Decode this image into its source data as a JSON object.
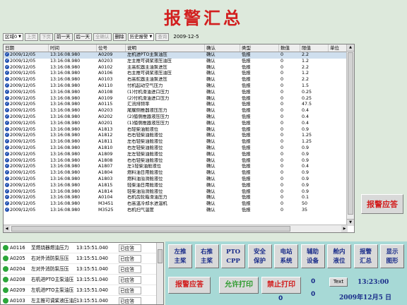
{
  "title": "报警汇总",
  "toolbar": {
    "region": "区域0",
    "prev_page": "上页",
    "next_page": "下页",
    "prev_day": "前一天",
    "next_day": "后一天",
    "confirm_all": "全确认",
    "delete": "删除",
    "history": "历史报警",
    "query": "查询",
    "date": "2009-12-5"
  },
  "grid": {
    "columns": [
      "日期",
      "时间",
      "位号",
      "说明",
      "确认",
      "类型",
      "数值",
      "限值",
      "单位"
    ],
    "rows": [
      [
        "2009/12/05",
        "13:16:08.980",
        "A0209",
        "左机进PTO主泵油压",
        "确认",
        "低报",
        "0",
        "2.2",
        ""
      ],
      [
        "2009/12/05",
        "13:16:08.980",
        "A0203",
        "左主推可调桨液压油压",
        "确认",
        "低报",
        "0",
        "1.2",
        ""
      ],
      [
        "2009/12/05",
        "13:16:08.980",
        "A0102",
        "主高舵器主油泵进压",
        "确认",
        "低报",
        "0",
        "2.2",
        ""
      ],
      [
        "2009/12/05",
        "13:16:08.980",
        "A0106",
        "右主推可调桨液压油压",
        "确认",
        "低报",
        "0",
        "1.2",
        ""
      ],
      [
        "2009/12/05",
        "13:16:08.980",
        "A0103",
        "右高舵器主油泵进压",
        "确认",
        "低报",
        "0",
        "2.2",
        ""
      ],
      [
        "2009/12/05",
        "13:16:08.980",
        "A0110",
        "付机起动空气压力",
        "确认",
        "低报",
        "0",
        "1.5",
        ""
      ],
      [
        "2009/12/05",
        "13:16:08.980",
        "A0108",
        "(1)付机滑油进口压力",
        "确认",
        "低报",
        "0",
        "0.25",
        ""
      ],
      [
        "2009/12/05",
        "13:16:08.980",
        "A0109",
        "(2)付机滑油进口压力",
        "确认",
        "低报",
        "0",
        "0.25",
        ""
      ],
      [
        "2009/12/05",
        "13:16:08.980",
        "A0115",
        "汇流排频率",
        "确认",
        "低报",
        "0",
        "47.5",
        ""
      ],
      [
        "2009/12/05",
        "13:16:08.980",
        "A0203",
        "尾艉侧推器液压压力",
        "确认",
        "低报",
        "0",
        "0.4",
        ""
      ],
      [
        "2009/12/05",
        "13:16:08.980",
        "A0202",
        "(2)艏侧推器液压压力",
        "确认",
        "低报",
        "0",
        "0.4",
        ""
      ],
      [
        "2009/12/05",
        "13:16:08.980",
        "A0201",
        "(1)艏侧推器液压压力",
        "确认",
        "低报",
        "0",
        "0.4",
        ""
      ],
      [
        "2009/12/05",
        "13:16:08.980",
        "A1813",
        "右轻柴油舱液位",
        "确认",
        "低报",
        "0",
        "0.9",
        ""
      ],
      [
        "2009/12/05",
        "13:16:08.980",
        "A1812",
        "右右轻柴油舱液位",
        "确认",
        "低报",
        "0",
        "1.25",
        ""
      ],
      [
        "2009/12/05",
        "13:16:08.980",
        "A1811",
        "左右轻柴油舱液位",
        "确认",
        "低报",
        "0",
        "1.25",
        ""
      ],
      [
        "2009/12/05",
        "13:16:08.980",
        "A1810",
        "右左轻柴油舱液位",
        "确认",
        "低报",
        "0",
        "0.9",
        ""
      ],
      [
        "2009/12/05",
        "13:16:08.980",
        "A1809",
        "左左轻柴油舱液位",
        "确认",
        "低报",
        "0",
        "0.9",
        ""
      ],
      [
        "2009/12/05",
        "13:16:08.980",
        "A1808",
        "右右轻柴油舱液位",
        "确认",
        "低报",
        "0",
        "0.9",
        ""
      ],
      [
        "2009/12/05",
        "13:16:08.980",
        "A1807",
        "左1轻柴油舱液位",
        "确认",
        "低报",
        "0",
        "0.4",
        ""
      ],
      [
        "2009/12/05",
        "13:16:08.980",
        "A1804",
        "燃料油日用舱液位",
        "确认",
        "低报",
        "0",
        "0.9",
        ""
      ],
      [
        "2009/12/05",
        "13:16:08.980",
        "A1803",
        "燃料油溢滑舱液位",
        "确认",
        "低报",
        "0",
        "0.9",
        ""
      ],
      [
        "2009/12/05",
        "13:16:08.980",
        "A1815",
        "轻柴油日用舱液位",
        "确认",
        "低报",
        "0",
        "0.9",
        ""
      ],
      [
        "2009/12/05",
        "13:16:08.980",
        "A1814",
        "轻柴油溢滑舱液位",
        "确认",
        "低报",
        "0",
        "0.9",
        ""
      ],
      [
        "2009/12/05",
        "13:16:08.980",
        "A0104",
        "右机齿轮箱滑油压力",
        "确认",
        "低报",
        "0",
        "0.1",
        ""
      ],
      [
        "2009/12/05",
        "13:16:08.980",
        "M3451",
        "右高温冷却水进温机",
        "确认",
        "低报",
        "0",
        "50",
        ""
      ],
      [
        "2009/12/05",
        "13:16:08.980",
        "M3525",
        "右机扫气温度",
        "确认",
        "低报",
        "0",
        "35",
        ""
      ]
    ]
  },
  "ack_side": "报警应答",
  "alarms": [
    {
      "code": "A0116",
      "desc": "至燃烧器燃油压力",
      "time": "13:15:51.040",
      "status": "已应答"
    },
    {
      "code": "A0205",
      "desc": "右对外消防泵压压",
      "time": "13:15:51.040",
      "status": "已应答"
    },
    {
      "code": "A0204",
      "desc": "左对外消防泵压压",
      "time": "13:15:51.040",
      "status": "已应答"
    },
    {
      "code": "A0208",
      "desc": "右机进PTO主泵油压",
      "time": "13:15:51.040",
      "status": "已应答"
    },
    {
      "code": "A0209",
      "desc": "左机进PTO主泵油压",
      "time": "13:15:51.040",
      "status": "已应答"
    },
    {
      "code": "A0103",
      "desc": "左主推可调桨液压油压",
      "time": "13:15:51.040",
      "status": "已应答"
    }
  ],
  "nav": [
    {
      "l1": "左推",
      "l2": "主桨"
    },
    {
      "l1": "右推",
      "l2": "主桨"
    },
    {
      "l1": "PTO",
      "l2": "CPP"
    },
    {
      "l1": "安全",
      "l2": "保护"
    },
    {
      "l1": "电站",
      "l2": "系统"
    },
    {
      "l1": "辅助",
      "l2": "设备"
    },
    {
      "l1": "舱内",
      "l2": "液位"
    },
    {
      "l1": "报警",
      "l2": "汇总"
    },
    {
      "l1": "显示",
      "l2": "图形"
    }
  ],
  "actions": {
    "ack": "报警应答",
    "allow_print": "允许打印",
    "stop_print": "禁止打印",
    "text_btn": "Text"
  },
  "counters": {
    "c1": "0",
    "c2": "0",
    "c3": "0"
  },
  "clock": {
    "time": "13:23:00",
    "date": "2009年12月5 日"
  },
  "colors": {
    "background": "#dde9dc",
    "panel": "#a7d9d6",
    "title": "#d21e1e",
    "nav_text": "#1a2d8a",
    "allow_print": "#2e9b2e",
    "stop_print": "#d21e1e"
  }
}
